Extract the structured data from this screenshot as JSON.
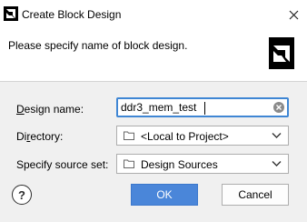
{
  "window": {
    "title": "Create Block Design",
    "close_icon": "close-icon",
    "app_icon": "amd-logo-icon"
  },
  "header": {
    "text": "Please specify name of block design.",
    "logo_icon": "amd-logo-icon"
  },
  "form": {
    "design_name": {
      "label_mnemonic": "D",
      "label_rest": "esign name:",
      "value": "ddr3_mem_test",
      "clear_icon": "clear-icon"
    },
    "directory": {
      "label_pre": "Di",
      "label_mnemonic": "r",
      "label_rest": "ectory:",
      "value": "<Local to Project>",
      "icon": "folder-icon"
    },
    "source_set": {
      "label": "Specify source set:",
      "value": "Design Sources",
      "icon": "folder-icon"
    }
  },
  "buttons": {
    "help": "?",
    "ok": "OK",
    "cancel": "Cancel"
  },
  "colors": {
    "accent": "#4a86d9",
    "focus_border": "#3f86d4",
    "brand": "#000000"
  }
}
